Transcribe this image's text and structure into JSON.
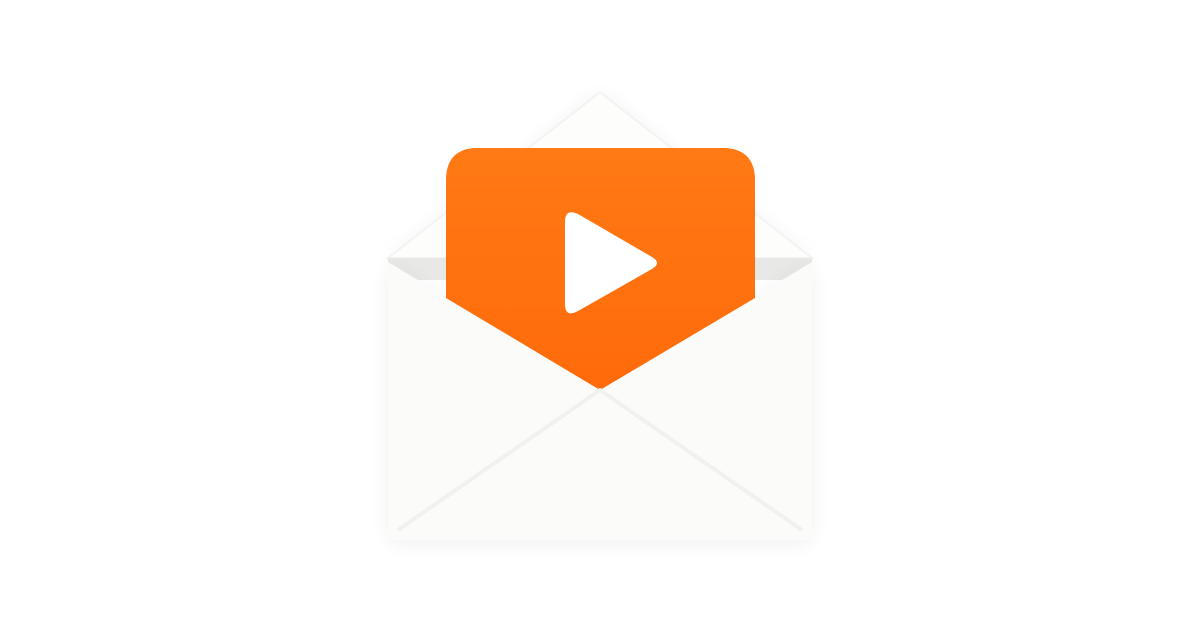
{
  "graphic": {
    "icon": "envelope-with-play-button-icon",
    "colors": {
      "background": "#ffffff",
      "envelope_body": "#fbfbfa",
      "envelope_flap": "#fdfdfc",
      "envelope_inner": "#e8e8e6",
      "envelope_lines": "#f1f1ef",
      "card_top": "#ff7a14",
      "card_bottom": "#ff6a0a",
      "play_glyph": "#ffffff"
    }
  }
}
